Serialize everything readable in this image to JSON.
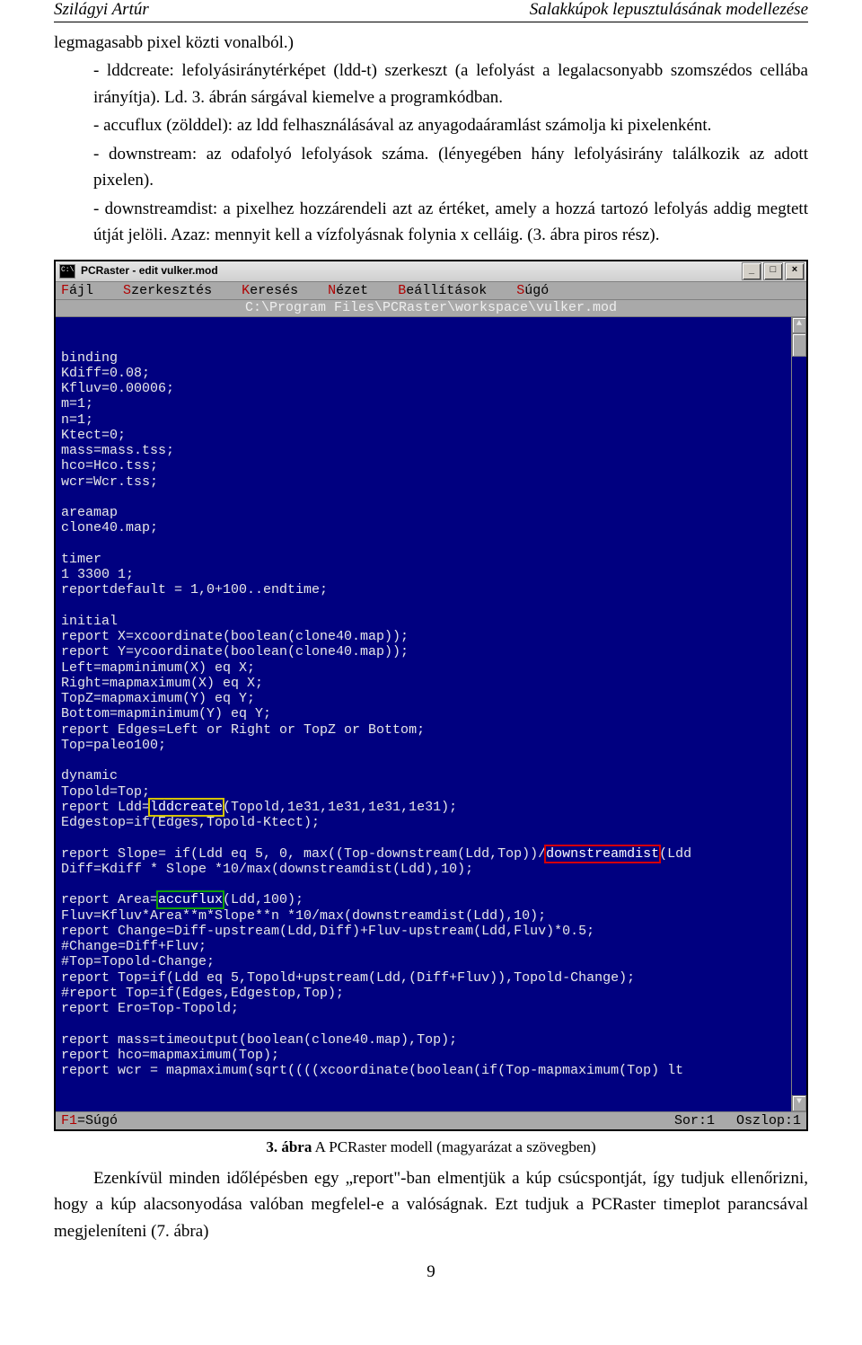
{
  "header": {
    "left": "Szilágyi Artúr",
    "right": "Salakkúpok lepusztulásának modellezése"
  },
  "body": {
    "para1": "legmagasabb pixel közti vonalból.)",
    "para2": "- lddcreate: lefolyásiránytérképet (ldd-t) szerkeszt (a lefolyást a legalacsonyabb szomszédos cellába irányítja). Ld. 3. ábrán sárgával kiemelve a programkódban.",
    "para3": "- accuflux (zölddel): az ldd felhasználásával az anyagodaáramlást számolja ki pixelenként.",
    "para4": "- downstream: az odafolyó lefolyások száma. (lényegében hány lefolyásirány találkozik az adott pixelen).",
    "para5": "- downstreamdist: a pixelhez hozzárendeli azt az értéket, amely a hozzá tartozó lefolyás addig megtett útját jelöli. Azaz: mennyit kell a vízfolyásnak folynia x celláig. (3. ábra piros rész)."
  },
  "terminal": {
    "window_title": "PCRaster - edit vulker.mod",
    "menu": [
      "Fájl",
      "Szerkesztés",
      "Keresés",
      "Nézet",
      "Beállítások",
      "Súgó"
    ],
    "path": "C:\\Program Files\\PCRaster\\workspace\\vulker.mod",
    "code": [
      "binding",
      "Kdiff=0.08;",
      "Kfluv=0.00006;",
      "m=1;",
      "n=1;",
      "Ktect=0;",
      "mass=mass.tss;",
      "hco=Hco.tss;",
      "wcr=Wcr.tss;",
      "",
      "areamap",
      "clone40.map;",
      "",
      "timer",
      "1 3300 1;",
      "reportdefault = 1,0+100..endtime;",
      "",
      "initial",
      "report X=xcoordinate(boolean(clone40.map));",
      "report Y=ycoordinate(boolean(clone40.map));",
      "Left=mapminimum(X) eq X;",
      "Right=mapmaximum(X) eq X;",
      "TopZ=mapmaximum(Y) eq Y;",
      "Bottom=mapminimum(Y) eq Y;",
      "report Edges=Left or Right or TopZ or Bottom;",
      "Top=paleo100;",
      "",
      "dynamic",
      "Topold=Top;",
      {
        "pre": "report Ldd=",
        "hi": "lddcreate",
        "hiClass": "hi-yellow",
        "post": "(Topold,1e31,1e31,1e31,1e31);"
      },
      "Edgestop=if(Edges,Topold-Ktect);",
      "",
      {
        "pre": "report Slope= if(Ldd eq 5, 0, max((Top-downstream(Ldd,Top))/",
        "hi": "downstreamdist",
        "hiClass": "hi-red",
        "post": "(Ldd"
      },
      "Diff=Kdiff * Slope *10/max(downstreamdist(Ldd),10);",
      "",
      {
        "pre": "report Area=",
        "hi": "accuflux",
        "hiClass": "hi-green",
        "post": "(Ldd,100);"
      },
      "Fluv=Kfluv*Area**m*Slope**n *10/max(downstreamdist(Ldd),10);",
      "report Change=Diff-upstream(Ldd,Diff)+Fluv-upstream(Ldd,Fluv)*0.5;",
      "#Change=Diff+Fluv;",
      "#Top=Topold-Change;",
      "report Top=if(Ldd eq 5,Topold+upstream(Ldd,(Diff+Fluv)),Topold-Change);",
      "#report Top=if(Edges,Edgestop,Top);",
      "report Ero=Top-Topold;",
      "",
      "report mass=timeoutput(boolean(clone40.map),Top);",
      "report hco=mapmaximum(Top);",
      "report wcr = mapmaximum(sqrt((((xcoordinate(boolean(if(Top-mapmaximum(Top) lt "
    ],
    "status": {
      "help": "F1=Súgó",
      "row": "Sor:1",
      "col": "Oszlop:1"
    }
  },
  "figcap": {
    "bold": "3. ábra",
    "rest": " A PCRaster modell (magyarázat a szövegben)"
  },
  "after": {
    "p1": "Ezenkívül minden időlépésben egy „report\"-ban elmentjük a kúp csúcspontját, így tudjuk ellenőrizni, hogy a kúp alacsonyodása valóban megfelel-e a valóságnak. Ezt tudjuk a PCRaster timeplot parancsával megjeleníteni (7. ábra)"
  },
  "pagenum": "9"
}
